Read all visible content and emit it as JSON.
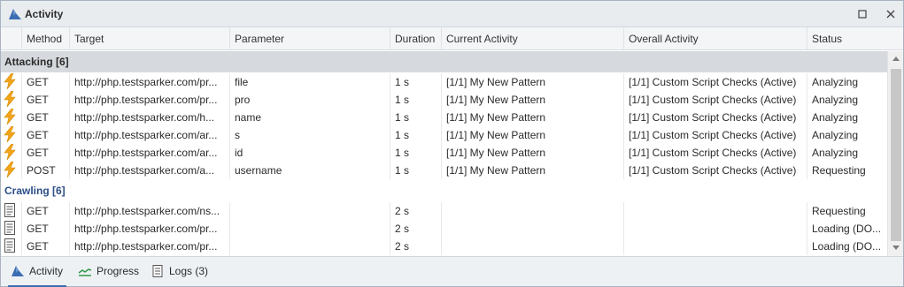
{
  "window": {
    "title": "Activity"
  },
  "columns": [
    "Method",
    "Target",
    "Parameter",
    "Duration",
    "Current Activity",
    "Overall Activity",
    "Status"
  ],
  "groups": {
    "attacking": {
      "label": "Attacking [6]",
      "rows": [
        {
          "icon": "lightning-icon",
          "method": "GET",
          "target": "http://php.testsparker.com/pr...",
          "parameter": "file",
          "duration": "1 s",
          "current": "[1/1] My New Pattern",
          "overall": "[1/1] Custom Script Checks (Active)",
          "status": "Analyzing"
        },
        {
          "icon": "lightning-icon",
          "method": "GET",
          "target": "http://php.testsparker.com/pr...",
          "parameter": "pro",
          "duration": "1 s",
          "current": "[1/1] My New Pattern",
          "overall": "[1/1] Custom Script Checks (Active)",
          "status": "Analyzing"
        },
        {
          "icon": "lightning-icon",
          "method": "GET",
          "target": "http://php.testsparker.com/h...",
          "parameter": "name",
          "duration": "1 s",
          "current": "[1/1] My New Pattern",
          "overall": "[1/1] Custom Script Checks (Active)",
          "status": "Analyzing"
        },
        {
          "icon": "lightning-icon",
          "method": "GET",
          "target": "http://php.testsparker.com/ar...",
          "parameter": "s",
          "duration": "1 s",
          "current": "[1/1] My New Pattern",
          "overall": "[1/1] Custom Script Checks (Active)",
          "status": "Analyzing"
        },
        {
          "icon": "lightning-icon",
          "method": "GET",
          "target": "http://php.testsparker.com/ar...",
          "parameter": "id",
          "duration": "1 s",
          "current": "[1/1] My New Pattern",
          "overall": "[1/1] Custom Script Checks (Active)",
          "status": "Analyzing"
        },
        {
          "icon": "lightning-icon",
          "method": "POST",
          "target": "http://php.testsparker.com/a...",
          "parameter": "username",
          "duration": "1 s",
          "current": "[1/1] My New Pattern",
          "overall": "[1/1] Custom Script Checks (Active)",
          "status": "Requesting"
        }
      ]
    },
    "crawling": {
      "label": "Crawling [6]",
      "rows": [
        {
          "icon": "document-icon",
          "method": "GET",
          "target": "http://php.testsparker.com/ns...",
          "parameter": "",
          "duration": "2 s",
          "current": "",
          "overall": "",
          "status": "Requesting"
        },
        {
          "icon": "document-icon",
          "method": "GET",
          "target": "http://php.testsparker.com/pr...",
          "parameter": "",
          "duration": "2 s",
          "current": "",
          "overall": "",
          "status": "Loading (DO..."
        },
        {
          "icon": "document-icon",
          "method": "GET",
          "target": "http://php.testsparker.com/pr...",
          "parameter": "",
          "duration": "2 s",
          "current": "",
          "overall": "",
          "status": "Loading (DO..."
        }
      ]
    }
  },
  "footer_tabs": [
    {
      "label": "Activity",
      "icon": "shark-icon"
    },
    {
      "label": "Progress",
      "icon": "progress-line-icon"
    },
    {
      "label": "Logs (3)",
      "icon": "logs-icon"
    }
  ],
  "colors": {
    "accent": "#3a6db2",
    "group_attacking_bg": "#d6d9dd",
    "group_crawling_text": "#2c4e86",
    "lightning": "#f2a51a"
  }
}
